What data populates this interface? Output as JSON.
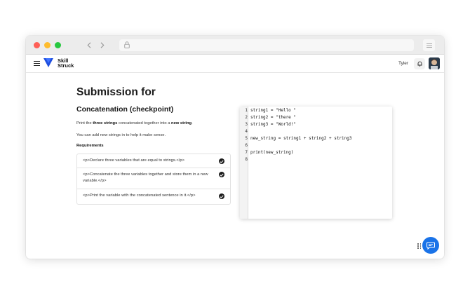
{
  "header": {
    "logo_line1": "Skill",
    "logo_line2": "Struck",
    "username": "Tyler"
  },
  "page": {
    "title": "Submission for",
    "subtitle": "Concatenation (checkpoint)",
    "instruction1_pre": "Print the ",
    "instruction1_bold1": "three strings",
    "instruction1_mid": " concatenated together into a ",
    "instruction1_bold2": "new string",
    "instruction1_post": ".",
    "instruction2": "You can add new strings in to help it make sense.",
    "requirements_label": "Requirements",
    "requirements": [
      "<p>Declare three variables that are equal to strings.</p>",
      "<p>Concatenate the three variables together and store them in a new variable.</p>",
      "<p>Print the variable with the concatenated sentence in it.</p>"
    ]
  },
  "editor": {
    "line_numbers": [
      "1",
      "2",
      "3",
      "4",
      "5",
      "6",
      "7",
      "8"
    ],
    "lines": [
      "string1 = \"Hello \"",
      "string2 = \"there \"",
      "string3 = \"World!\"",
      "",
      "new_string = string1 + string2 + string3",
      "",
      "print(new_string)",
      ""
    ]
  },
  "icons": {
    "back": "chevron-left-icon",
    "forward": "chevron-right-icon",
    "lock": "lock-icon",
    "menu": "hamburger-menu-icon",
    "notifications": "bell-icon",
    "check": "check-circle-icon",
    "chat": "chat-bubble-icon",
    "grip": "drag-grip-icon"
  },
  "colors": {
    "accent": "#1a73e8",
    "logo_blue": "#1f4fe0",
    "close": "#fe5f57",
    "minimize": "#febc2e",
    "maximize": "#28c840"
  }
}
